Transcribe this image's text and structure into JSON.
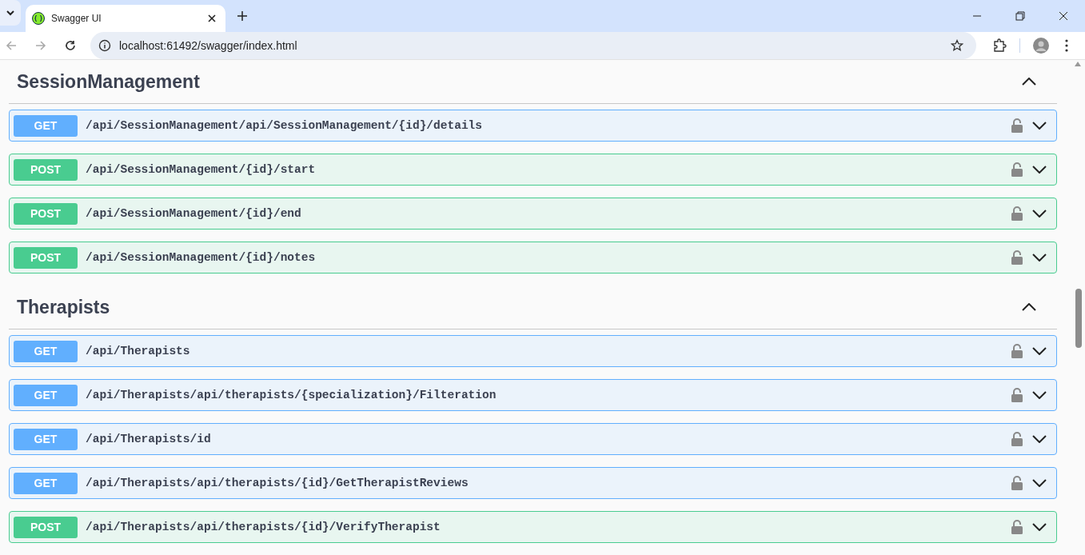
{
  "browser": {
    "tabs": [
      {
        "title": "Swagger UI",
        "selected": true
      }
    ],
    "address": "localhost:61492/swagger/index.html"
  },
  "sections": [
    {
      "name": "SessionManagement",
      "expanded": true,
      "operations": [
        {
          "method": "GET",
          "kind": "get",
          "path": "/api/SessionManagement/api/SessionManagement/{id}/details",
          "expanded": false
        },
        {
          "method": "POST",
          "kind": "post",
          "path": "/api/SessionManagement/{id}/start",
          "expanded": false
        },
        {
          "method": "POST",
          "kind": "post",
          "path": "/api/SessionManagement/{id}/end",
          "expanded": false
        },
        {
          "method": "POST",
          "kind": "post",
          "path": "/api/SessionManagement/{id}/notes",
          "expanded": false
        }
      ]
    },
    {
      "name": "Therapists",
      "expanded": true,
      "operations": [
        {
          "method": "GET",
          "kind": "get",
          "path": "/api/Therapists",
          "expanded": false
        },
        {
          "method": "GET",
          "kind": "get",
          "path": "/api/Therapists/api/therapists/{specialization}/Filteration",
          "expanded": false
        },
        {
          "method": "GET",
          "kind": "get",
          "path": "/api/Therapists/id",
          "expanded": false
        },
        {
          "method": "GET",
          "kind": "get",
          "path": "/api/Therapists/api/therapists/{id}/GetTherapistReviews",
          "expanded": false
        },
        {
          "method": "POST",
          "kind": "post",
          "path": "/api/Therapists/api/therapists/{id}/VerifyTherapist",
          "expanded": false
        }
      ]
    }
  ]
}
